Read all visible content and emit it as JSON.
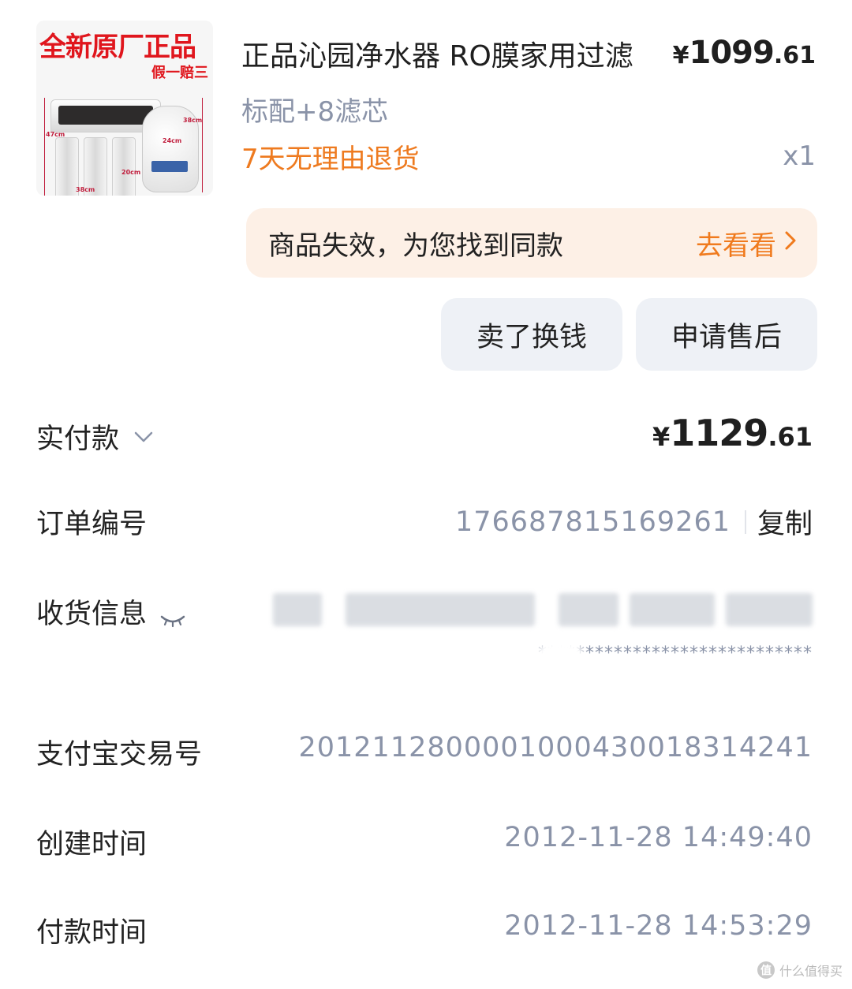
{
  "product": {
    "image_badge_main": "全新原厂正品",
    "image_badge_sub": "假一赔三",
    "image_dims": [
      "38cm",
      "47cm",
      "24cm",
      "20cm",
      "38cm"
    ],
    "title": "正品沁园净水器 RO膜家用过滤",
    "price_symbol": "¥",
    "price_int": "1099",
    "price_dec": ".61",
    "spec": "标配+8滤芯",
    "return_policy": "7天无理由退货",
    "quantity": "x1"
  },
  "notice": {
    "text": "商品失效，为您找到同款",
    "link_label": "去看看",
    "link_icon": "chevron-right-icon"
  },
  "actions": {
    "sell_label": "卖了换钱",
    "after_sale_label": "申请售后"
  },
  "order": {
    "paid_label": "实付款",
    "paid_symbol": "¥",
    "paid_int": "1129",
    "paid_dec": ".61",
    "order_no_label": "订单编号",
    "order_no": "176687815169261",
    "copy_label": "复制",
    "shipping_label": "收货信息",
    "shipping_masked": "*****************************",
    "alipay_label": "支付宝交易号",
    "alipay_no": "2012112800001000430018314241",
    "created_label": "创建时间",
    "created_time": "2012-11-28 14:49:40",
    "paid_time_label": "付款时间",
    "paid_time": "2012-11-28 14:53:29"
  },
  "watermark": {
    "icon_text": "值",
    "text": "什么值得买"
  },
  "colors": {
    "accent_orange": "#f07a1d",
    "muted_text": "#8a93a8",
    "notice_bg": "#fdf0e6",
    "button_bg": "#eef1f6",
    "badge_red": "#e0161d"
  }
}
